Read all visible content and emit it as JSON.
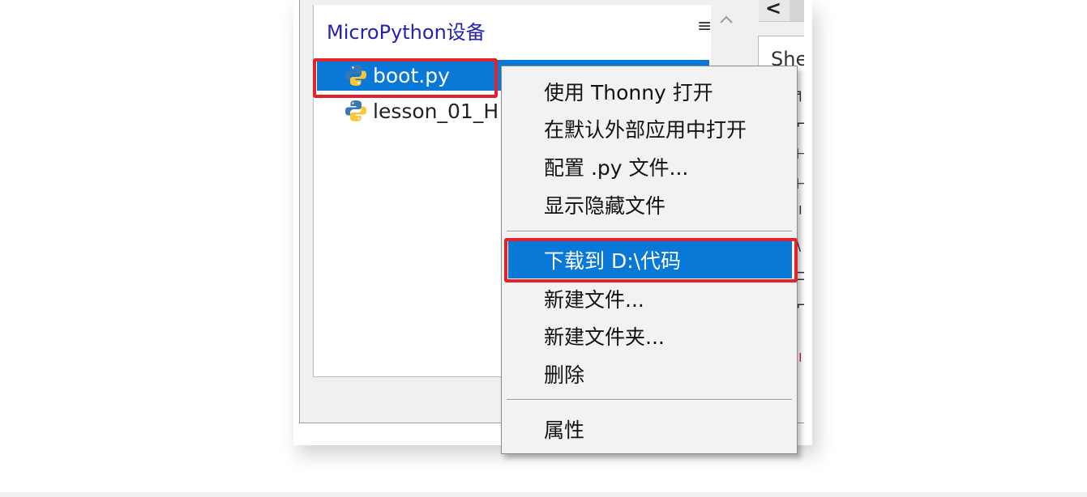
{
  "panel": {
    "title": "MicroPython设备",
    "menu_icon": "≡"
  },
  "files": [
    {
      "name": "boot.py",
      "icon": "python-file-icon",
      "selected": true
    },
    {
      "name": "lesson_01_H",
      "icon": "python-file-icon",
      "selected": false
    }
  ],
  "right_panel": {
    "nav_arrow": "<",
    "shell_label": "She"
  },
  "context_menu": {
    "items": [
      {
        "label": "使用 Thonny 打开"
      },
      {
        "label": "在默认外部应用中打开"
      },
      {
        "label": "配置 .py 文件..."
      },
      {
        "label": "显示隐藏文件"
      },
      {
        "label": "下载到 D:\\代码",
        "selected": true
      },
      {
        "label": "新建文件..."
      },
      {
        "label": "新建文件夹..."
      },
      {
        "label": "删除"
      },
      {
        "label": "属性"
      }
    ]
  },
  "colors": {
    "selection": "#0a78d7",
    "highlight_box": "#e0242a",
    "panel_title": "#2323b0"
  }
}
